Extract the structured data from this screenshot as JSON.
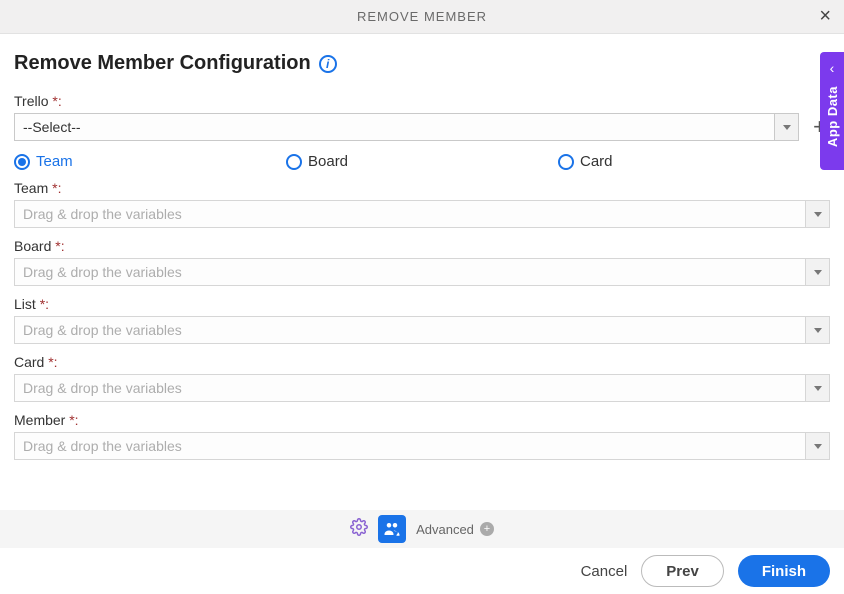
{
  "titlebar": {
    "title": "REMOVE MEMBER"
  },
  "page": {
    "title": "Remove Member Configuration"
  },
  "trello": {
    "label": "Trello ",
    "req": "*:",
    "selected": "--Select--"
  },
  "radios": {
    "team": "Team",
    "board": "Board",
    "card": "Card",
    "selected": "team"
  },
  "fields": {
    "team": {
      "label": "Team ",
      "req": "*:",
      "placeholder": "Drag & drop the variables"
    },
    "board": {
      "label": "Board ",
      "req": "*:",
      "placeholder": "Drag & drop the variables"
    },
    "list": {
      "label": "List ",
      "req": "*:",
      "placeholder": "Drag & drop the variables"
    },
    "card": {
      "label": "Card ",
      "req": "*:",
      "placeholder": "Drag & drop the variables"
    },
    "member": {
      "label": "Member ",
      "req": "*:",
      "placeholder": "Drag & drop the variables"
    }
  },
  "toolbar": {
    "advanced": "Advanced"
  },
  "footer": {
    "cancel": "Cancel",
    "prev": "Prev",
    "finish": "Finish"
  },
  "side": {
    "label": "App Data"
  }
}
